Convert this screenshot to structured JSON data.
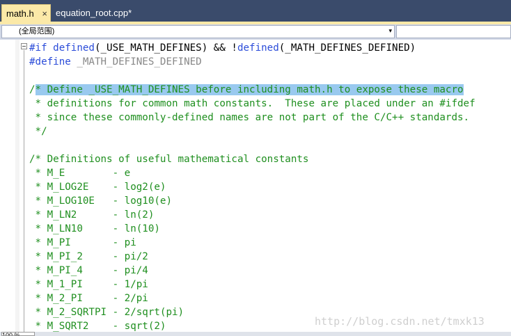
{
  "tabs": [
    {
      "label": "math.h",
      "active": true,
      "close_icon": "×"
    },
    {
      "label": "equation_root.cpp*",
      "active": false
    }
  ],
  "nav": {
    "scope_dropdown": "(全局范围)"
  },
  "code_lines": [
    [
      {
        "t": "#if ",
        "c": "kw"
      },
      {
        "t": "defined",
        "c": "kw"
      },
      {
        "t": "(_USE_MATH_DEFINES) && !"
      },
      {
        "t": "defined",
        "c": "kw"
      },
      {
        "t": "(_MATH_DEFINES_DEFINED)"
      }
    ],
    [
      {
        "t": "#define ",
        "c": "kw"
      },
      {
        "t": "_MATH_DEFINES_DEFINED",
        "c": "pp"
      }
    ],
    [
      {
        "t": ""
      }
    ],
    [
      {
        "t": "/",
        "c": "cm"
      },
      {
        "t": "* Define _USE_MATH_DEFINES before including math.h to expose these macro",
        "c": "cm sel"
      }
    ],
    [
      {
        "t": " * definitions for common math constants.  These are placed under an #ifdef",
        "c": "cm"
      }
    ],
    [
      {
        "t": " * since these commonly-defined names are not part of the C/C++ standards.",
        "c": "cm"
      }
    ],
    [
      {
        "t": " */",
        "c": "cm"
      }
    ],
    [
      {
        "t": ""
      }
    ],
    [
      {
        "t": "/* Definitions of useful mathematical constants",
        "c": "cm"
      }
    ],
    [
      {
        "t": " * M_E        - e",
        "c": "cm"
      }
    ],
    [
      {
        "t": " * M_LOG2E    - log2(e)",
        "c": "cm"
      }
    ],
    [
      {
        "t": " * M_LOG10E   - log10(e)",
        "c": "cm"
      }
    ],
    [
      {
        "t": " * M_LN2      - ln(2)",
        "c": "cm"
      }
    ],
    [
      {
        "t": " * M_LN10     - ln(10)",
        "c": "cm"
      }
    ],
    [
      {
        "t": " * M_PI       - pi",
        "c": "cm"
      }
    ],
    [
      {
        "t": " * M_PI_2     - pi/2",
        "c": "cm"
      }
    ],
    [
      {
        "t": " * M_PI_4     - pi/4",
        "c": "cm"
      }
    ],
    [
      {
        "t": " * M_1_PI     - 1/pi",
        "c": "cm"
      }
    ],
    [
      {
        "t": " * M_2_PI     - 2/pi",
        "c": "cm"
      }
    ],
    [
      {
        "t": " * M_2_SQRTPI - 2/sqrt(pi)",
        "c": "cm"
      }
    ],
    [
      {
        "t": " * M_SQRT2    - sqrt(2)",
        "c": "cm"
      }
    ]
  ],
  "watermark": "http://blog.csdn.net/tmxk13",
  "status": {
    "zoom": "100 %"
  }
}
